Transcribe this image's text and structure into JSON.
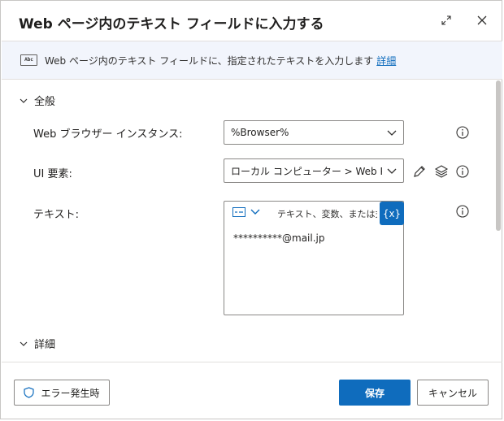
{
  "dialog": {
    "title": "Web ページ内のテキスト フィールドに入力する",
    "description": "Web ページ内のテキスト フィールドに、指定されたテキストを入力します",
    "description_link": "詳細",
    "abc_icon_text": "Abc"
  },
  "sections": {
    "general": "全般",
    "advanced": "詳細"
  },
  "fields": {
    "browser_instance": {
      "label": "Web ブラウザー インスタンス:",
      "value": "%Browser%"
    },
    "ui_element": {
      "label": "UI 要素:",
      "value": "ローカル コンピューター > Web Page 'ht"
    },
    "text": {
      "label": "テキスト:",
      "placeholder": "テキスト、変数、または式と",
      "variable_button": "{x}",
      "value": "**********@mail.jp"
    }
  },
  "footer": {
    "on_error": "エラー発生時",
    "save": "保存",
    "cancel": "キャンセル"
  },
  "colors": {
    "accent": "#0f6cbd",
    "description_bg": "#f2f5fc"
  },
  "icons": [
    "expand-icon",
    "close-icon",
    "abc-icon",
    "chevron-down-icon",
    "info-icon",
    "pencil-icon",
    "layers-icon",
    "shield-icon"
  ]
}
